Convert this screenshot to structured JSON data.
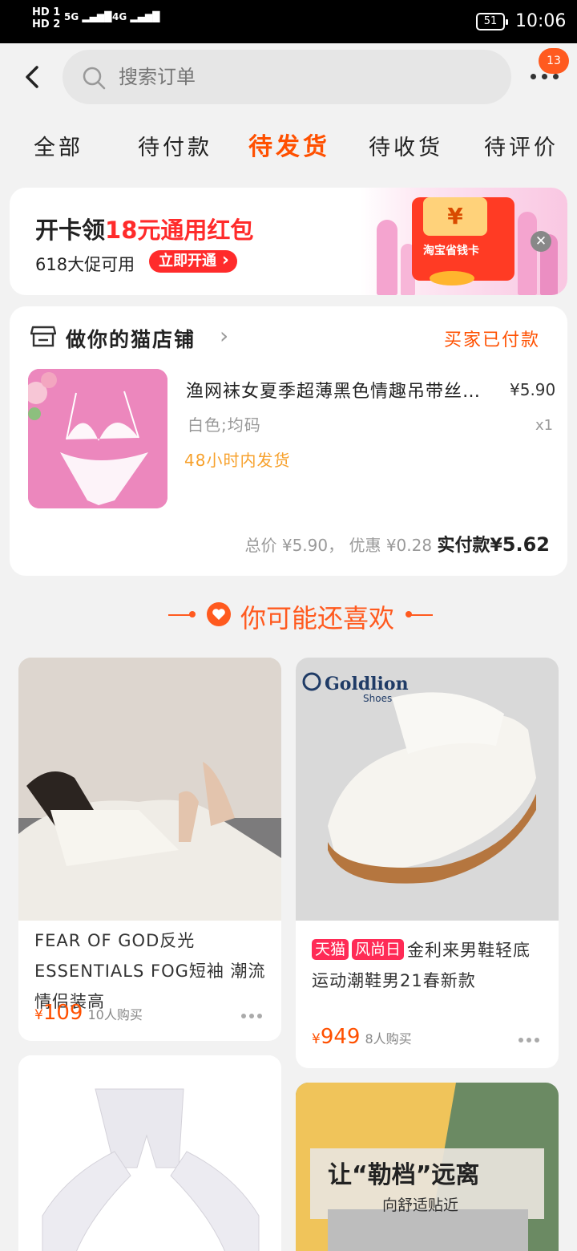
{
  "status_bar": {
    "network_left": [
      "HD 1",
      "HD 2"
    ],
    "signal1": "5G",
    "signal2": "4G",
    "battery": "51",
    "time": "10:06"
  },
  "header": {
    "search_placeholder": "搜索订单",
    "notification_count": "13",
    "tabs": [
      {
        "label": "全部",
        "active": false
      },
      {
        "label": "待付款",
        "active": false
      },
      {
        "label": "待发货",
        "active": true
      },
      {
        "label": "待收货",
        "active": false
      },
      {
        "label": "待评价",
        "active": false
      }
    ]
  },
  "banner": {
    "title_prefix": "开卡领",
    "title_highlight": "18元通用红包",
    "subtitle": "618大促可用",
    "button": "立即开通",
    "card_symbol": "¥",
    "card_label": "淘宝省钱卡"
  },
  "order": {
    "shop_name": "做你的猫店铺",
    "status": "买家已付款",
    "item_title": "渔网袜女夏季超薄黑色情趣吊带丝袜性感",
    "item_price": "¥5.90",
    "item_sku": "白色;均码",
    "item_qty": "x1",
    "shipping_note": "48小时内发货",
    "total_label": "总价",
    "total": "¥5.90",
    "discount_label": "优惠",
    "discount": "¥0.28",
    "paid_label": "实付款",
    "paid_currency": "¥",
    "paid": "5.62"
  },
  "recommend": {
    "title": "你可能还喜欢",
    "products": [
      {
        "name": "FEAR OF GOD反光ESSENTIALS FOG短袖 潮流情侣装高",
        "price": "109",
        "currency": "¥",
        "sold": "10人购买"
      },
      {
        "tags": [
          "天猫",
          "风尚日"
        ],
        "name": "金利来男鞋轻底运动潮鞋男21春新款",
        "price": "949",
        "currency": "¥",
        "sold": "8人购买",
        "brand": "Goldlion",
        "brand_sub": "Shoes"
      },
      {
        "name": ""
      },
      {
        "ad_title": "让“勒档”远离",
        "ad_sub": "向舒适贴近"
      }
    ]
  },
  "colors": {
    "accent": "#ff5000",
    "price": "#ff5000",
    "tmall_tag": "#ff2b56",
    "background": "#f2f2f2"
  }
}
